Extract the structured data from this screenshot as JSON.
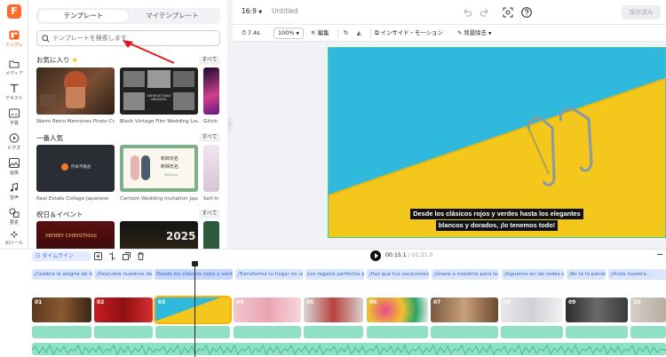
{
  "rail": {
    "logo": "F",
    "items": [
      {
        "label": "テンプレ",
        "icon": "template-icon"
      },
      {
        "label": "メディア",
        "icon": "media-icon"
      },
      {
        "label": "テキスト",
        "icon": "text-icon"
      },
      {
        "label": "字幕",
        "icon": "subtitle-icon"
      },
      {
        "label": "ビデオ",
        "icon": "video-icon"
      },
      {
        "label": "画像",
        "icon": "image-icon"
      },
      {
        "label": "音声",
        "icon": "audio-icon"
      },
      {
        "label": "要素",
        "icon": "elements-icon"
      },
      {
        "label": "AIツール",
        "icon": "ai-tools-icon"
      },
      {
        "label": "ツール",
        "icon": "tools-icon"
      }
    ]
  },
  "panel": {
    "tabs": [
      "テンプレート",
      "マイテンプレート"
    ],
    "search_placeholder": "テンプレートを検索します",
    "all_label": "すべて",
    "sections": [
      {
        "title": "お気に入り",
        "cards": [
          "Warm Retro Memories Photo Col...",
          "Black Vintage Film Wedding Lov...",
          "Glitch"
        ]
      },
      {
        "title": "一番人気",
        "cards": [
          "Real Estate Collage Japanese",
          "Cartoon Wedding Invitation Japa...",
          "Self In"
        ]
      },
      {
        "title": "祝日＆イベント",
        "cards": [
          "",
          "",
          ""
        ]
      }
    ],
    "thumb_texts": {
      "vintage_title": "UNFORGETTABLE MEMORIES",
      "realestate": "内本不動産",
      "wedding_names1": "新郎氏名",
      "wedding_names2": "新婦氏名",
      "wedding_tag": "Wedding",
      "xmas": "MERRY CHRISTMAS",
      "ny": "2025"
    }
  },
  "topbar": {
    "aspect": "16:9",
    "doc_title": "Untitled",
    "save_label": "保存済み"
  },
  "toolbar": {
    "duration": "7.4s",
    "zoom": "100%",
    "edit": "編集",
    "inside_motion": "インサイド・モーション",
    "bg_remove": "背景除去"
  },
  "canvas": {
    "subtitle_line1": "Desde los clásicos rojos y verdes hasta los elegantes",
    "subtitle_line2": "blancos y dorados, ¡lo tenemos todo!",
    "colors": {
      "water": "#2fb9dc",
      "floor": "#f3c71c"
    }
  },
  "timeline": {
    "timeline_label": "タイムライン",
    "current_time": "00:15.1",
    "total_time": "/ 01:21.0",
    "captions": [
      "¡Celebra la alegría de la...",
      "¡Descubre nuestros de...",
      "Desde los clásicos rojos y verd...",
      "¡Transforma tu hogar en un...",
      "Los regalos perfectos p...",
      "¡Haz que tus vacaciones...",
      "¡Únase a nosotros para la...",
      "¡Síguenos en las redes s...",
      "¡No te lo pierdas! ¡Nues...",
      "¡Visite nuestra..."
    ],
    "clip_numbers": [
      "01",
      "02",
      "03",
      "04",
      "05",
      "06",
      "07",
      "08",
      "09",
      "10",
      "11"
    ]
  }
}
